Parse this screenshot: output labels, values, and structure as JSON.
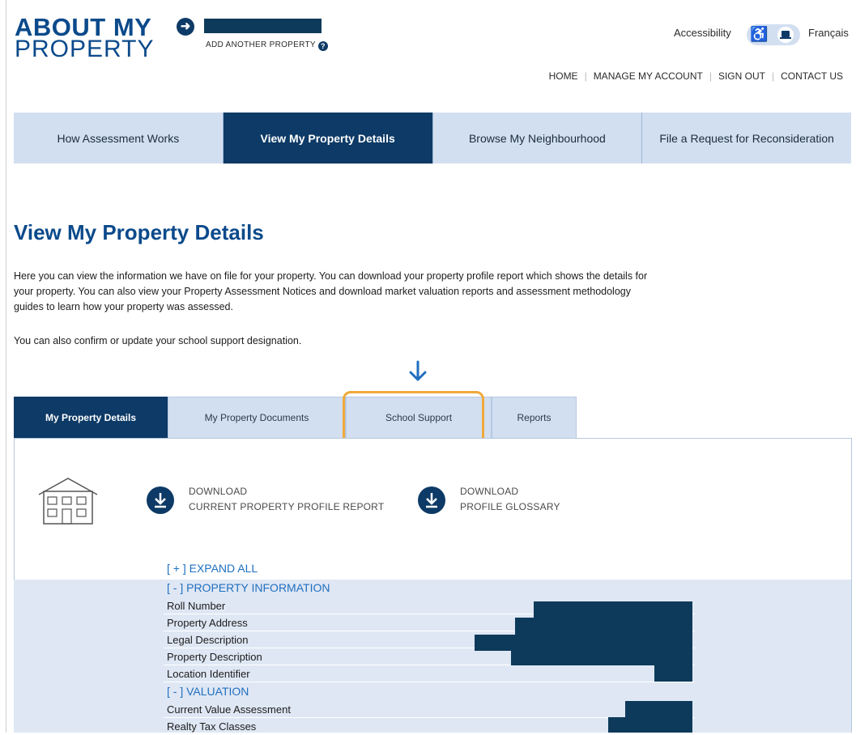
{
  "header": {
    "logo_line1": "ABOUT MY",
    "logo_line2": "PROPERTY",
    "add_property": "ADD ANOTHER PROPERTY",
    "accessibility": "Accessibility",
    "language": "Français"
  },
  "top_nav": [
    "HOME",
    "MANAGE MY ACCOUNT",
    "SIGN OUT",
    "CONTACT US"
  ],
  "main_nav": [
    {
      "label": "How Assessment Works",
      "active": false
    },
    {
      "label": "View My Property Details",
      "active": true
    },
    {
      "label": "Browse My Neighbourhood",
      "active": false
    },
    {
      "label": "File a Request for Reconsideration",
      "active": false
    }
  ],
  "page": {
    "title": "View My Property Details",
    "intro": "Here you can view the information we have on file for your property. You can download your property profile report which shows the details for your property. You can also view your Property Assessment Notices and download market valuation reports and assessment methodology guides to learn how your property was assessed.",
    "intro2": "You can also confirm or update your school support designation."
  },
  "sub_tabs": [
    {
      "label": "My Property Details",
      "active": true
    },
    {
      "label": "My Property Documents",
      "active": false
    },
    {
      "label": "School Support",
      "active": false,
      "highlighted": true
    },
    {
      "label": "Reports",
      "active": false
    }
  ],
  "downloads": [
    {
      "line1": "DOWNLOAD",
      "line2": "CURRENT PROPERTY PROFILE REPORT"
    },
    {
      "line1": "DOWNLOAD",
      "line2": "PROFILE GLOSSARY"
    }
  ],
  "details": {
    "expand_all": "[ + ] EXPAND ALL",
    "property_section": "[ - ] PROPERTY INFORMATION",
    "property_rows": [
      "Roll Number",
      "Property Address",
      "Legal Description",
      "Property Description",
      "Location Identifier"
    ],
    "valuation_section": "[ - ] VALUATION",
    "valuation_rows": [
      "Current Value Assessment",
      "Realty Tax Classes"
    ]
  },
  "colors": {
    "brand_dark": "#0d3a66",
    "brand_light": "#d2dff0",
    "link_blue": "#1f6fbf",
    "highlight": "#f0a93a"
  }
}
